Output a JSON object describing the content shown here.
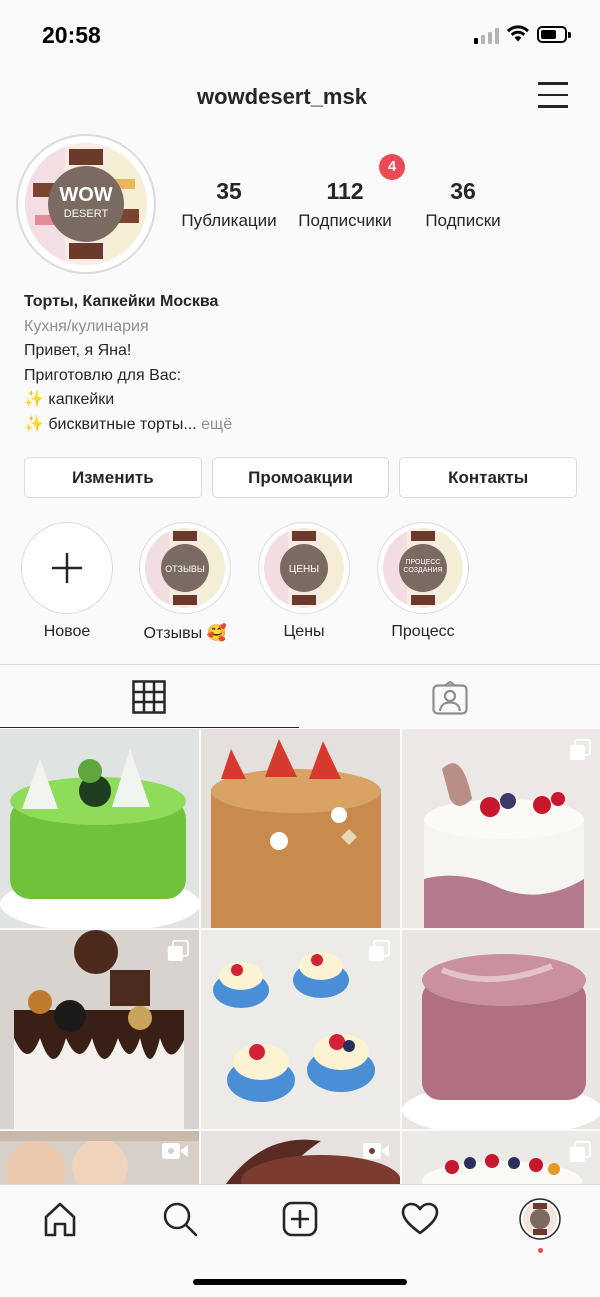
{
  "status_bar": {
    "time": "20:58"
  },
  "header": {
    "username": "wowdesert_msk",
    "notification_count": "4"
  },
  "profile": {
    "avatar_logo_line1": "WOW",
    "avatar_logo_line2": "DESERT",
    "stats": [
      {
        "value": "35",
        "label": "Публикации"
      },
      {
        "value": "112",
        "label": "Подписчики"
      },
      {
        "value": "36",
        "label": "Подписки"
      }
    ],
    "bio": {
      "name": "Торты, Капкейки Москва",
      "category": "Кухня/кулинария",
      "line1": "Привет, я Яна!",
      "line2": "Приготовлю для Вас:",
      "line3": "✨ капкейки",
      "line4": "✨ бисквитные торты...",
      "more": "ещё"
    }
  },
  "buttons": {
    "edit": "Изменить",
    "promo": "Промоакции",
    "contacts": "Контакты"
  },
  "highlights": [
    {
      "label": "Новое",
      "cover_text": ""
    },
    {
      "label": "Отзывы 🥰",
      "cover_text": "ОТЗЫВЫ"
    },
    {
      "label": "Цены",
      "cover_text": "ЦЕНЫ"
    },
    {
      "label": "Процесс",
      "cover_text": "ПРОЦЕСС СОЗДАНИЯ"
    }
  ],
  "colors": {
    "accent_red": "#ed4956",
    "border": "#dbdbdb",
    "secondary_text": "#8e8e8e"
  },
  "icons": [
    "menu-icon",
    "plus-icon",
    "grid-icon",
    "tagged-icon",
    "carousel-icon",
    "video-icon",
    "home-icon",
    "search-icon",
    "new-post-icon",
    "heart-icon",
    "profile-avatar"
  ]
}
